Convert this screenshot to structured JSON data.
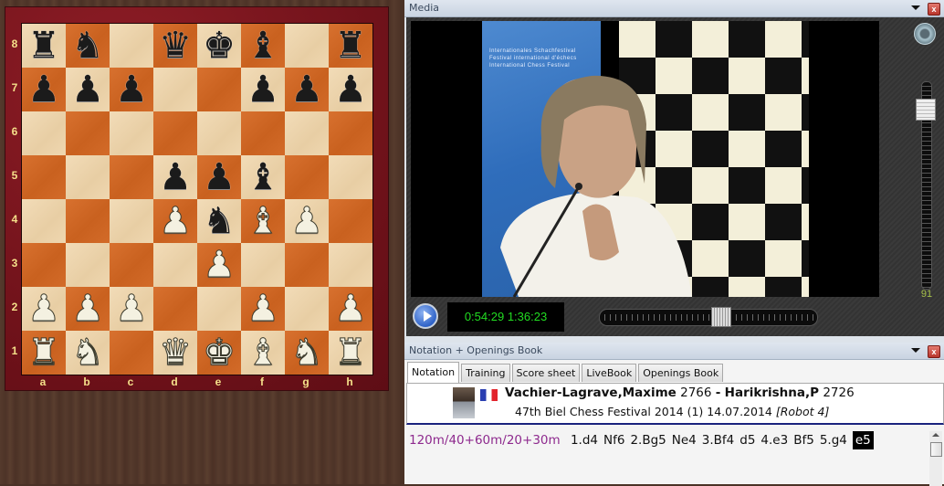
{
  "board": {
    "files": [
      "a",
      "b",
      "c",
      "d",
      "e",
      "f",
      "g",
      "h"
    ],
    "ranks": [
      "8",
      "7",
      "6",
      "5",
      "4",
      "3",
      "2",
      "1"
    ],
    "position": [
      [
        "bR",
        "bN",
        "",
        "bQ",
        "bK",
        "bB",
        "",
        "bR"
      ],
      [
        "bP",
        "bP",
        "bP",
        "",
        "",
        "bP",
        "bP",
        "bP"
      ],
      [
        "",
        "",
        "",
        "",
        "",
        "",
        "",
        ""
      ],
      [
        "",
        "",
        "",
        "bP",
        "bP",
        "bB",
        "",
        ""
      ],
      [
        "",
        "",
        "",
        "wP",
        "bN",
        "wB",
        "wP",
        ""
      ],
      [
        "",
        "",
        "",
        "",
        "wP",
        "",
        "",
        ""
      ],
      [
        "wP",
        "wP",
        "wP",
        "",
        "",
        "wP",
        "",
        "wP"
      ],
      [
        "wR",
        "wN",
        "",
        "wQ",
        "wK",
        "wB",
        "wN",
        "wR"
      ]
    ],
    "pieces": {
      "K": "♚",
      "Q": "♛",
      "R": "♜",
      "B": "♝",
      "N": "♞",
      "P": "♟"
    }
  },
  "media": {
    "title": "Media",
    "time_current": "0:54:29",
    "time_total": "1:36:23",
    "seek_fraction": 0.565,
    "volume": "91",
    "volume_fraction": 0.91,
    "banner_lines": [
      "Internationales  Schachfestival",
      "Festival international  d'échecs",
      "International Chess Festival"
    ],
    "play_icon": "play-icon",
    "speaker_icon": "speaker-icon"
  },
  "notation": {
    "title": "Notation + Openings Book",
    "tabs": [
      "Notation",
      "Training",
      "Score sheet",
      "LiveBook",
      "Openings Book"
    ],
    "active_tab": 0,
    "white_player": "Vachier-Lagrave,Maxime",
    "white_elo": "2766",
    "separator": "-",
    "black_player": "Harikrishna,P",
    "black_elo": "2726",
    "event": "47th Biel Chess Festival 2014 (1) 14.07.2014",
    "annotator": "[Robot 4]",
    "time_control": "120m/40+60m/20+30m",
    "moves": [
      "1.d4",
      "Nf6",
      "2.Bg5",
      "Ne4",
      "3.Bf4",
      "d5",
      "4.e3",
      "Bf5",
      "5.g4",
      "e5"
    ],
    "current_move_index": 9
  },
  "colors": {
    "board_light": "#efd7b0",
    "board_dark": "#d06a28",
    "frame": "#7a141c",
    "coord": "#f5e08a",
    "timecode": "#22dd22",
    "volume_value": "#a6c04a",
    "time_control": "#8e2a8e"
  }
}
